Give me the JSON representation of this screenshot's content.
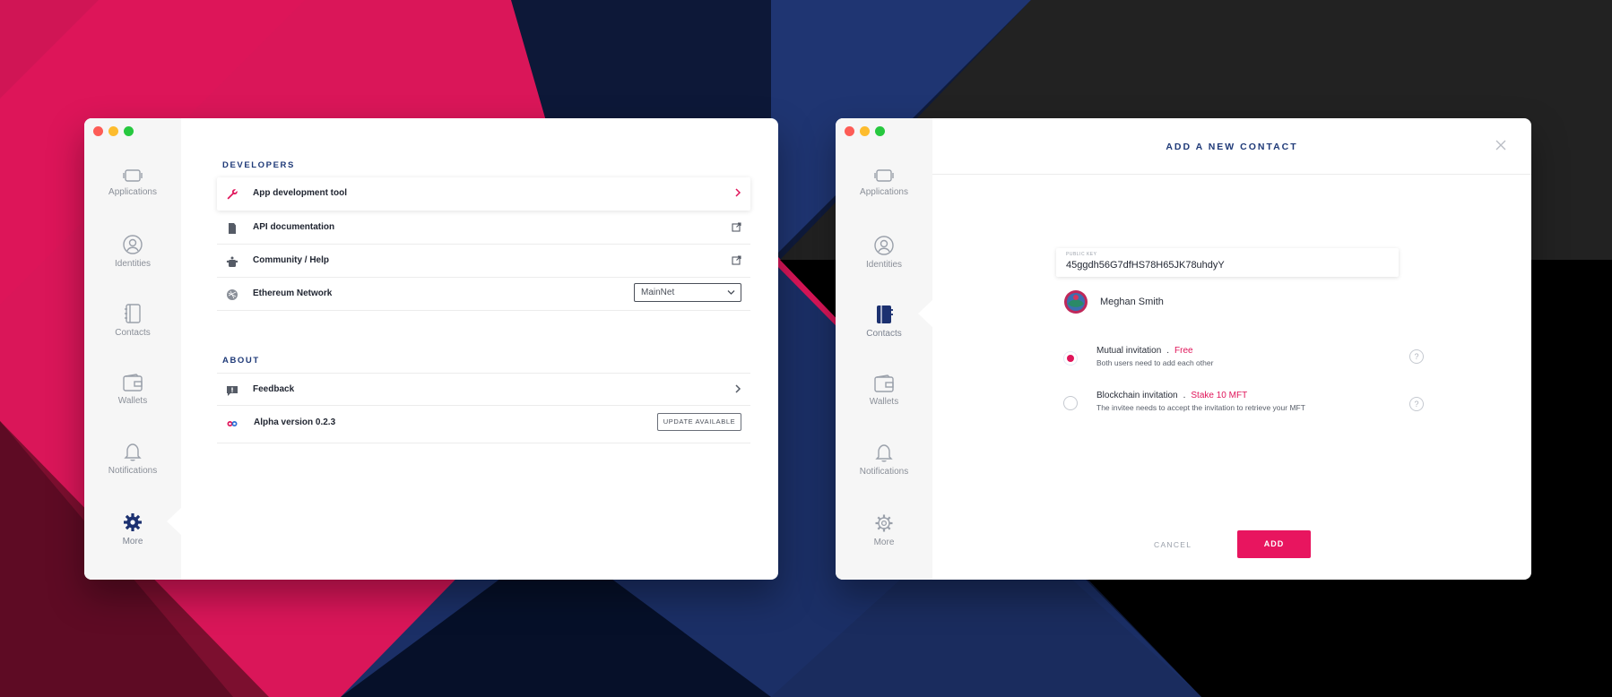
{
  "colors": {
    "accent": "#e8155f",
    "navy": "#1f3a78",
    "sidebar": "#f6f6f6"
  },
  "nav": {
    "items": [
      {
        "label": "Applications",
        "icon": "applications-icon"
      },
      {
        "label": "Identities",
        "icon": "identity-icon"
      },
      {
        "label": "Contacts",
        "icon": "contacts-icon"
      },
      {
        "label": "Wallets",
        "icon": "wallet-icon"
      },
      {
        "label": "Notifications",
        "icon": "bell-icon"
      },
      {
        "label": "More",
        "icon": "gear-icon"
      }
    ]
  },
  "settings": {
    "developers_title": "DEVELOPERS",
    "developers": [
      {
        "label": "App development tool",
        "icon": "wrench-icon",
        "right": "chevron-right-icon"
      },
      {
        "label": "API documentation",
        "icon": "document-icon",
        "right": "external-link-icon"
      },
      {
        "label": "Community / Help",
        "icon": "community-icon",
        "right": "external-link-icon"
      },
      {
        "label": "Ethereum Network",
        "icon": "ethereum-icon",
        "select_value": "MainNet"
      }
    ],
    "about_title": "ABOUT",
    "about": [
      {
        "label": "Feedback",
        "icon": "feedback-icon",
        "right": "chevron-right-icon"
      },
      {
        "label": "Alpha version 0.2.3",
        "icon": "logo-icon",
        "button": "UPDATE AVAILABLE"
      }
    ]
  },
  "modal": {
    "title": "ADD A NEW CONTACT",
    "public_key_caption": "PUBLIC KEY",
    "public_key_value": "45ggdh56G7dfHS78H65JK78uhdyY",
    "contact_name": "Meghan Smith",
    "options": [
      {
        "title": "Mutual invitation",
        "sep": ".",
        "price": "Free",
        "desc": "Both users need to add each other",
        "selected": true
      },
      {
        "title": "Blockchain invitation",
        "sep": ".",
        "price": "Stake 10 MFT",
        "desc": "The invitee needs to accept the invitation to retrieve your MFT",
        "selected": false
      }
    ],
    "help_glyph": "?",
    "cancel_label": "CANCEL",
    "add_label": "ADD"
  }
}
